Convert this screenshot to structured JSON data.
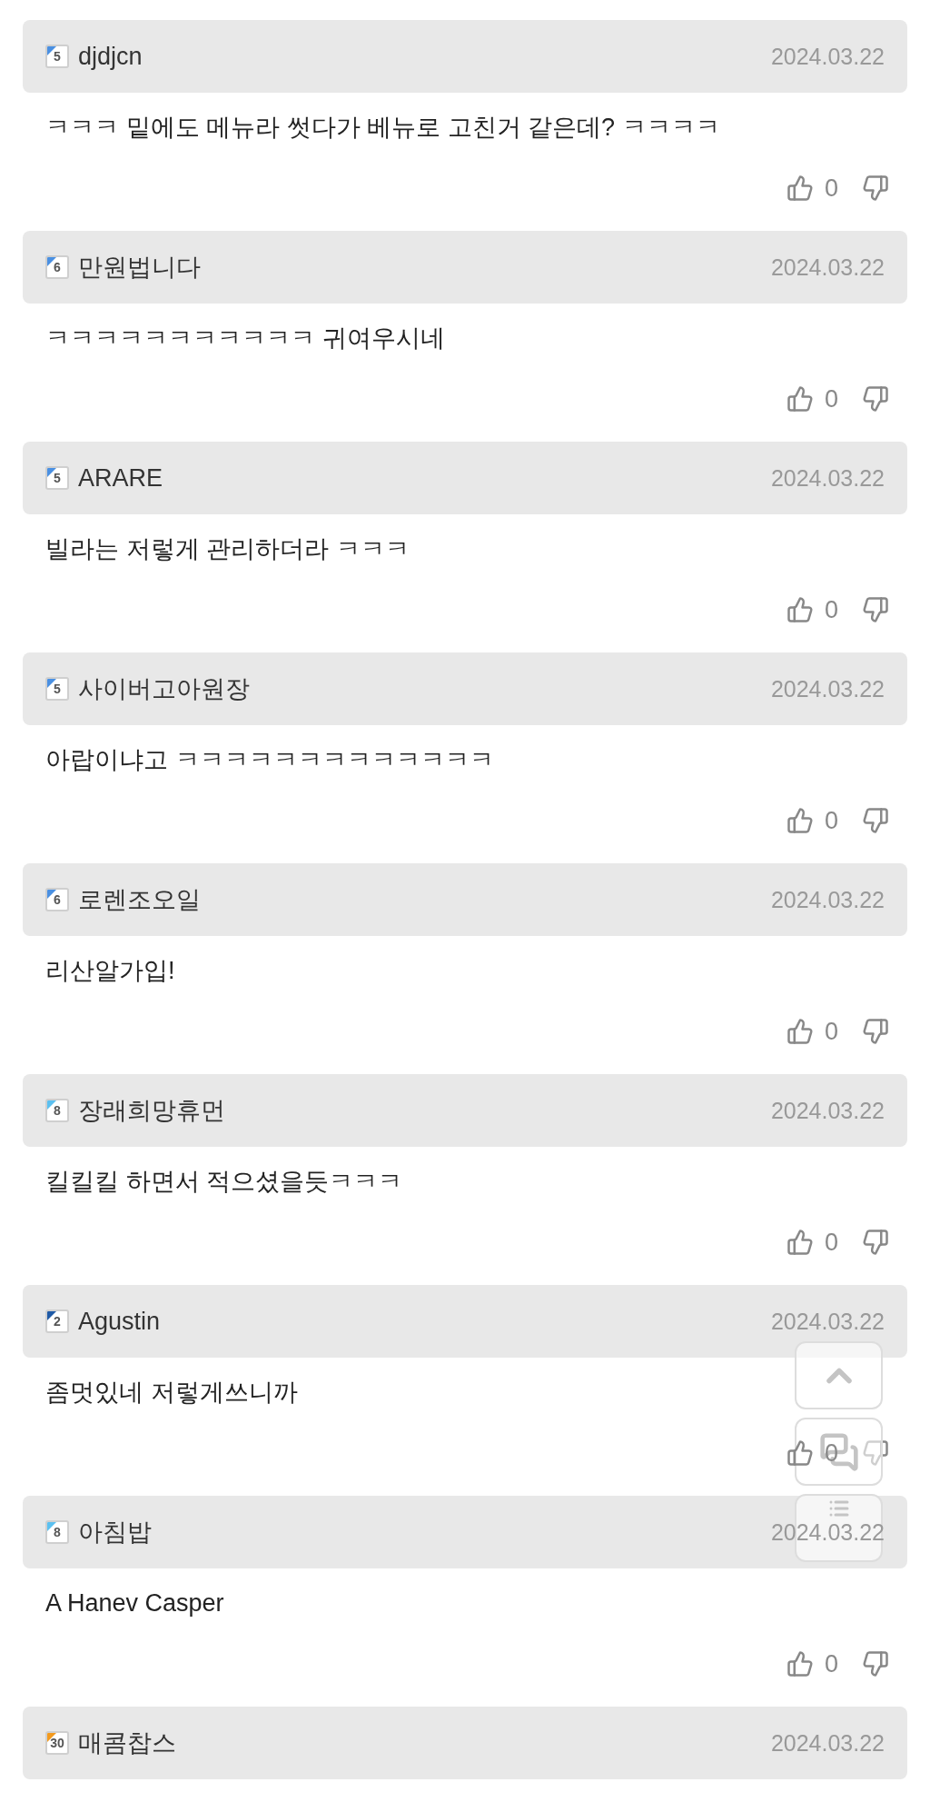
{
  "comments": [
    {
      "level": "5",
      "color": "#4a90e2",
      "author": "djdjcn",
      "date": "2024.03.22",
      "text": "ㅋㅋㅋ 밑에도 메뉴라 썻다가 베뉴로 고친거 같은데? ㅋㅋㅋㅋ",
      "likes": "0"
    },
    {
      "level": "6",
      "color": "#4a90e2",
      "author": "만원법니다",
      "date": "2024.03.22",
      "text": "ㅋㅋㅋㅋㅋㅋㅋㅋㅋㅋㅋ 귀여우시네",
      "likes": "0"
    },
    {
      "level": "5",
      "color": "#4a90e2",
      "author": "ARARE",
      "date": "2024.03.22",
      "text": "빌라는 저렇게 관리하더라 ㅋㅋㅋ",
      "likes": "0"
    },
    {
      "level": "5",
      "color": "#4a90e2",
      "author": "사이버고아원장",
      "date": "2024.03.22",
      "text": "아랍이냐고 ㅋㅋㅋㅋㅋㅋㅋㅋㅋㅋㅋㅋㅋ",
      "likes": "0"
    },
    {
      "level": "6",
      "color": "#4a90e2",
      "author": "로렌조오일",
      "date": "2024.03.22",
      "text": "리산알가입!",
      "likes": "0"
    },
    {
      "level": "8",
      "color": "#5bc0f0",
      "author": "장래희망휴먼",
      "date": "2024.03.22",
      "text": "킬킬킬 하면서 적으셨을듯ㅋㅋㅋ",
      "likes": "0"
    },
    {
      "level": "2",
      "color": "#1f5aa6",
      "author": "Agustin",
      "date": "2024.03.22",
      "text": "좀멋있네 저렇게쓰니까",
      "likes": "0"
    },
    {
      "level": "8",
      "color": "#5bc0f0",
      "author": "아침밥",
      "date": "2024.03.22",
      "text": "A Hanev Casper",
      "likes": "0"
    },
    {
      "level": "30",
      "color": "#f39a1e",
      "author": "매콤찹스",
      "date": "2024.03.22"
    }
  ]
}
